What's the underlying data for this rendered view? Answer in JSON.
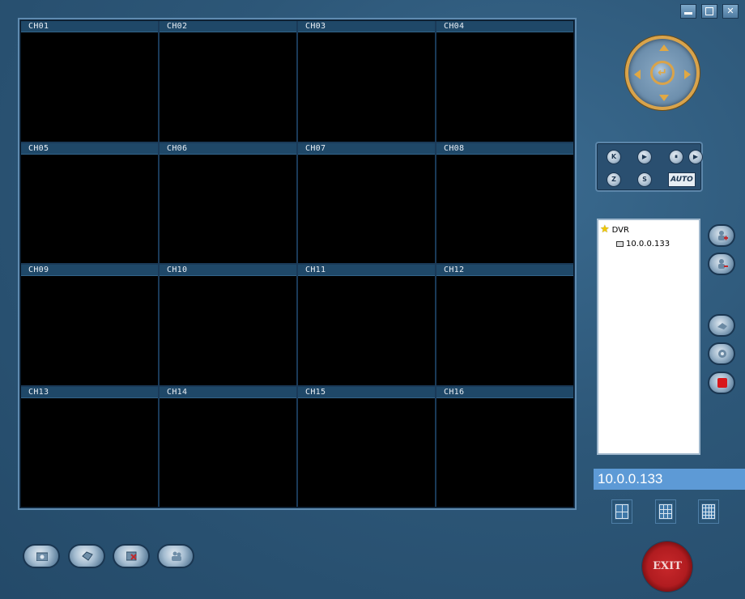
{
  "window": {
    "controls": [
      {
        "name": "minimize",
        "icon": "minimize-icon"
      },
      {
        "name": "maximize",
        "icon": "maximize-icon"
      },
      {
        "name": "close",
        "icon": "close-icon",
        "glyph": "✕"
      }
    ]
  },
  "channels": [
    "CH01",
    "CH02",
    "CH03",
    "CH04",
    "CH05",
    "CH06",
    "CH07",
    "CH08",
    "CH09",
    "CH10",
    "CH11",
    "CH12",
    "CH13",
    "CH14",
    "CH15",
    "CH16"
  ],
  "ptz": {
    "center_glyph": "↵"
  },
  "playback": {
    "buttons": [
      "K",
      "▶",
      "⏸",
      "▶",
      "Z",
      "S"
    ],
    "auto_label": "AUTO"
  },
  "tree": {
    "root": "DVR",
    "child": "10.0.0.133"
  },
  "ip_display": "10.0.0.133",
  "exit_label": "EXIT",
  "colors": {
    "background": "#2d5778",
    "accent_gold": "#d9a34a",
    "record_red": "#d8181c",
    "ip_bar": "#5d9ad6"
  }
}
